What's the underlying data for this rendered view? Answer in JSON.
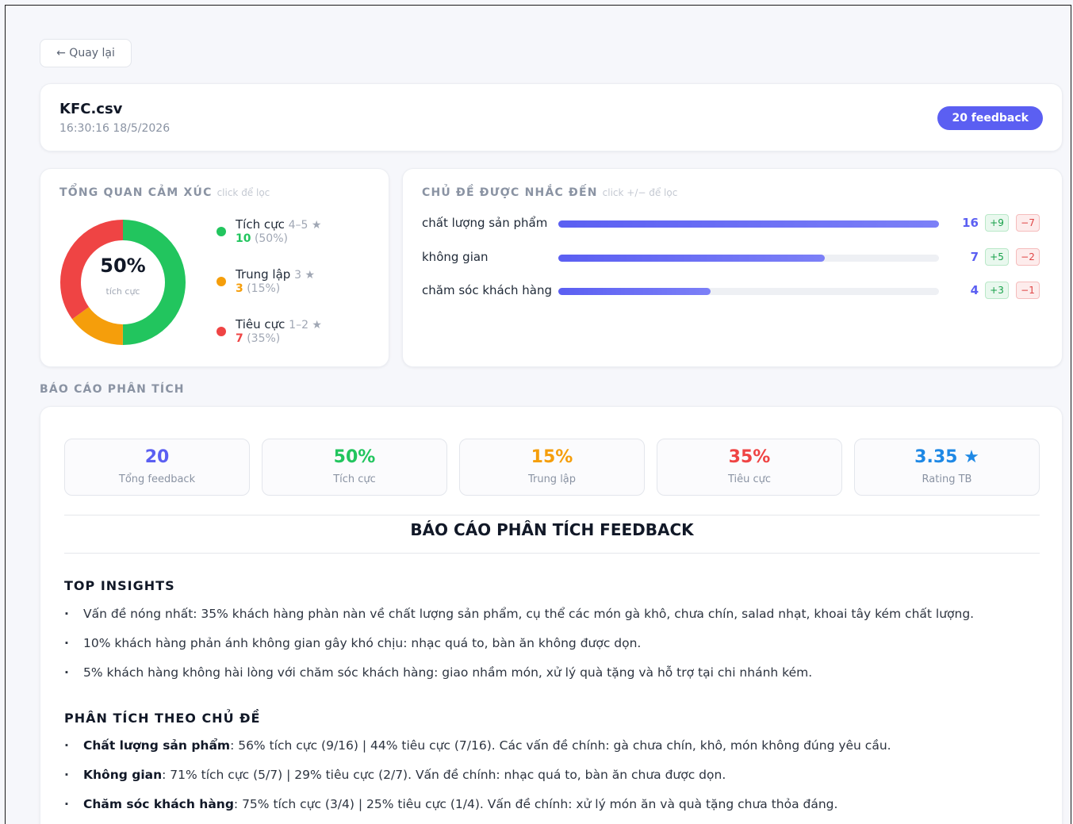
{
  "back": {
    "label": "← Quay lại"
  },
  "file": {
    "name": "KFC.csv",
    "time": "16:30:16 18/5/2026",
    "badge": "20 feedback"
  },
  "sentiment": {
    "title": "TỔNG QUAN CẢM XÚC",
    "hint": "click để lọc",
    "center_pct": "50%",
    "center_label": "tích cực",
    "items": [
      {
        "name": "Tích cực",
        "stars": "4–5 ★",
        "count": "10",
        "pct": "(50%)",
        "color": "#22c55e",
        "share": 0.5
      },
      {
        "name": "Trung lập",
        "stars": "3 ★",
        "count": "3",
        "pct": "(15%)",
        "color": "#f59e0b",
        "share": 0.15
      },
      {
        "name": "Tiêu cực",
        "stars": "1–2 ★",
        "count": "7",
        "pct": "(35%)",
        "color": "#ef4444",
        "share": 0.35
      }
    ]
  },
  "topics": {
    "title": "CHỦ ĐỀ ĐƯỢC NHẮC ĐẾN",
    "hint": "click +/− để lọc",
    "items": [
      {
        "name": "chất lượng sản phẩm",
        "count": "16",
        "pos": "+9",
        "neg": "−7",
        "share": 1.0
      },
      {
        "name": "không gian",
        "count": "7",
        "pos": "+5",
        "neg": "−2",
        "share": 0.7
      },
      {
        "name": "chăm sóc khách hàng",
        "count": "4",
        "pos": "+3",
        "neg": "−1",
        "share": 0.4
      }
    ]
  },
  "report_section_title": "BÁO CÁO PHÂN TÍCH",
  "stats": [
    {
      "value": "20",
      "label": "Tổng feedback",
      "color": "#5b5ff2"
    },
    {
      "value": "50%",
      "label": "Tích cực",
      "color": "#22c55e"
    },
    {
      "value": "15%",
      "label": "Trung lập",
      "color": "#f59e0b"
    },
    {
      "value": "35%",
      "label": "Tiêu cực",
      "color": "#ef4444"
    },
    {
      "value": "3.35 ★",
      "label": "Rating TB",
      "color": "#1e88e5"
    }
  ],
  "report": {
    "heading": "BÁO CÁO PHÂN TÍCH FEEDBACK",
    "insights_title": "TOP INSIGHTS",
    "insights": [
      "Vấn đề nóng nhất: 35% khách hàng phàn nàn về chất lượng sản phẩm, cụ thể các món gà khô, chưa chín, salad nhạt, khoai tây kém chất lượng.",
      "10% khách hàng phản ánh không gian gây khó chịu: nhạc quá to, bàn ăn không được dọn.",
      "5% khách hàng không hài lòng với chăm sóc khách hàng: giao nhầm món, xử lý quà tặng và hỗ trợ tại chi nhánh kém."
    ],
    "topics_title": "PHÂN TÍCH THEO CHỦ ĐỀ",
    "topic_analysis": [
      {
        "name": "Chất lượng sản phẩm",
        "text": ": 56% tích cực (9/16) | 44% tiêu cực (7/16). Các vấn đề chính: gà chưa chín, khô, món không đúng yêu cầu."
      },
      {
        "name": "Không gian",
        "text": ": 71% tích cực (5/7) | 29% tiêu cực (2/7). Vấn đề chính: nhạc quá to, bàn ăn chưa được dọn."
      },
      {
        "name": "Chăm sóc khách hàng",
        "text": ": 75% tích cực (3/4) | 25% tiêu cực (1/4). Vấn đề chính: xử lý món ăn và quà tặng chưa thỏa đáng."
      }
    ]
  }
}
